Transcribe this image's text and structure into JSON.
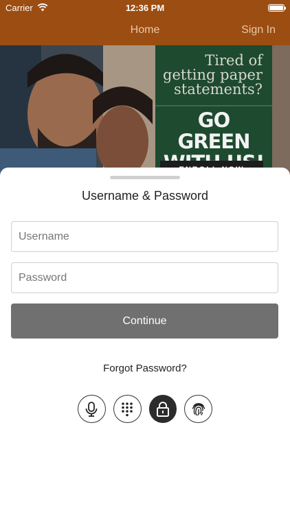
{
  "status_bar": {
    "carrier": "Carrier",
    "time": "12:36 PM"
  },
  "nav": {
    "title": "Home",
    "sign_in": "Sign In"
  },
  "banner": {
    "headline": "Tired of getting paper statements?",
    "cta": "GO GREEN WITH US!",
    "button": "ENROLL NOW"
  },
  "login": {
    "title": "Username & Password",
    "username_placeholder": "Username",
    "password_placeholder": "Password",
    "continue_label": "Continue",
    "forgot_label": "Forgot Password?"
  },
  "auth_methods": [
    {
      "icon": "microphone-icon",
      "active": false
    },
    {
      "icon": "keypad-icon",
      "active": false
    },
    {
      "icon": "lock-icon",
      "active": true
    },
    {
      "icon": "fingerprint-icon",
      "active": false
    }
  ],
  "colors": {
    "header": "#9c4d12",
    "promo_green": "#1e4a2f",
    "button_gray": "#707070"
  }
}
